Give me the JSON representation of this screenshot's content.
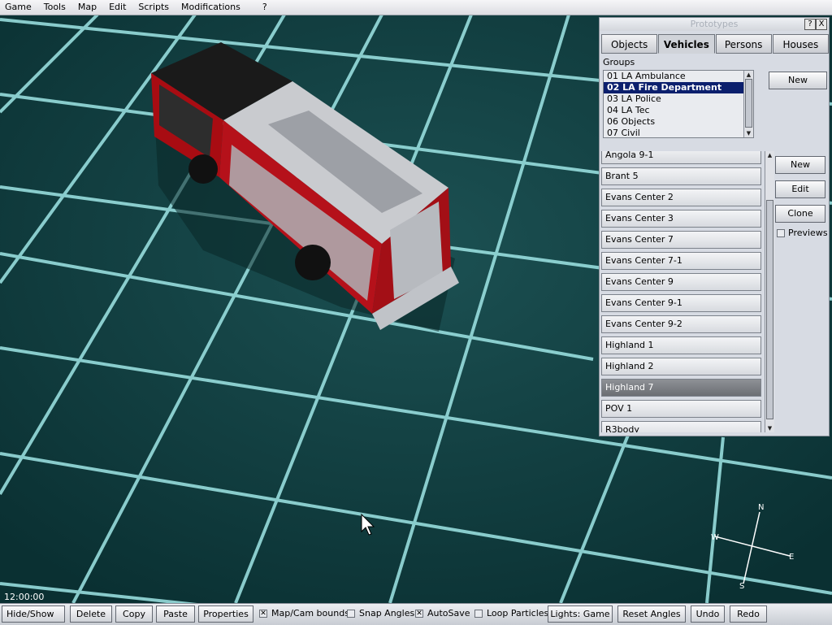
{
  "menu": [
    "Game",
    "Tools",
    "Map",
    "Edit",
    "Scripts",
    "Modifications",
    "?"
  ],
  "panel": {
    "title": "Prototypes",
    "help_btn": "?",
    "close_btn": "X",
    "tabs": [
      "Objects",
      "Vehicles",
      "Persons",
      "Houses"
    ],
    "active_tab": "Vehicles",
    "groups_label": "Groups",
    "groups": [
      "01 LA Ambulance",
      "02 LA Fire Department",
      "03 LA Police",
      "04 LA Tec",
      "06 Objects",
      "07 Civil"
    ],
    "selected_group": "02 LA Fire Department",
    "group_new": "New",
    "prototypes": [
      "Angola 9-1",
      "Brant 5",
      "Evans Center 2",
      "Evans Center 3",
      "Evans Center 7",
      "Evans Center 7-1",
      "Evans Center 9",
      "Evans Center 9-1",
      "Evans Center 9-2",
      "Highland 1",
      "Highland 2",
      "Highland 7",
      "POV 1",
      "R3body"
    ],
    "selected_prototype": "Highland 7",
    "buttons": {
      "new": "New",
      "edit": "Edit",
      "clone": "Clone"
    },
    "previews_label": "Previews",
    "previews_checked": false
  },
  "clock": "12:00:00",
  "compass": {
    "n": "N",
    "e": "E",
    "s": "S",
    "w": "W"
  },
  "toolbar": {
    "hide_show": "Hide/Show",
    "delete": "Delete",
    "copy": "Copy",
    "paste": "Paste",
    "properties": "Properties",
    "map_cam_bounds": {
      "label": "Map/Cam bounds",
      "checked": true
    },
    "snap_angles": {
      "label": "Snap Angles",
      "checked": false
    },
    "autosave": {
      "label": "AutoSave",
      "checked": true
    },
    "loop_particles": {
      "label": "Loop Particles",
      "checked": false
    },
    "lights": "Lights: Game",
    "reset_angles": "Reset Angles",
    "undo": "Undo",
    "redo": "Redo"
  },
  "colors": {
    "background": "#0d3b3c",
    "grid": "#8fe3e3",
    "selection": "#0b1f6d",
    "truck_body": "#b01016"
  }
}
